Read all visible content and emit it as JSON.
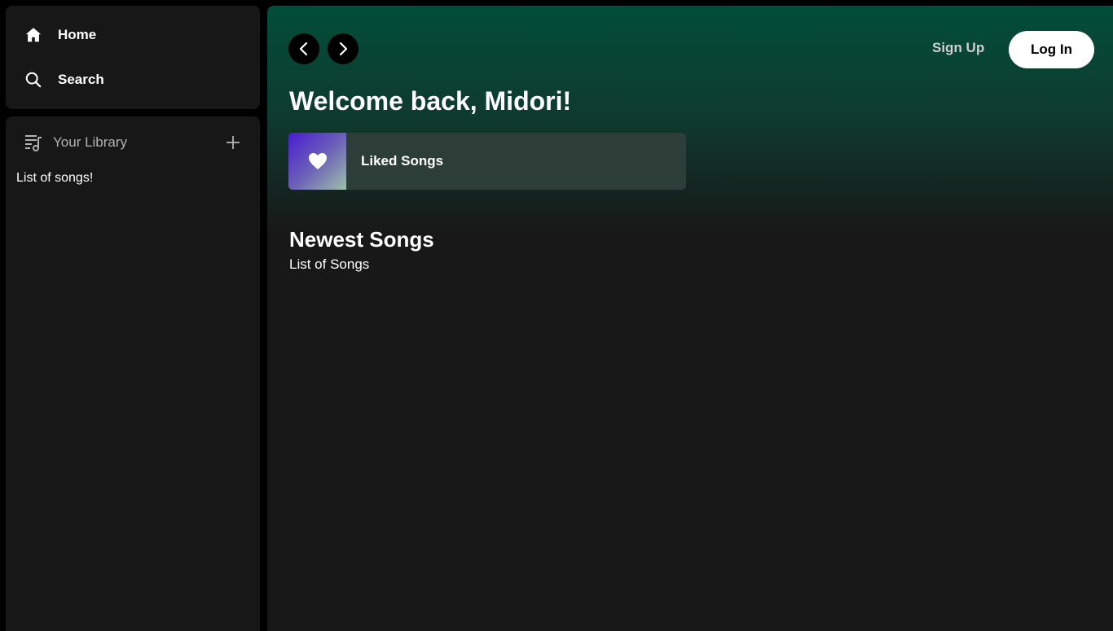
{
  "sidebar": {
    "nav": {
      "home_label": "Home",
      "search_label": "Search"
    },
    "library": {
      "title": "Your Library",
      "content_text": "List of songs!"
    }
  },
  "header": {
    "signup_label": "Sign Up",
    "login_label": "Log In"
  },
  "main": {
    "welcome": "Welcome back, Midori!",
    "liked_card_label": "Liked Songs",
    "section_title": "Newest Songs",
    "section_subtitle": "List of Songs"
  },
  "colors": {
    "background": "#000000",
    "panel": "#171717",
    "gradient_top": "#024d3a",
    "main_bg": "#181818",
    "liked_card": "#2d3d38",
    "liked_art_start": "#4a1bd0",
    "liked_art_end": "#9ebfa8"
  },
  "icons": {
    "home": "home-icon",
    "search": "search-icon",
    "library": "library-icon",
    "add": "plus-icon",
    "back": "chevron-left-icon",
    "forward": "chevron-right-icon",
    "liked": "heart-icon"
  }
}
